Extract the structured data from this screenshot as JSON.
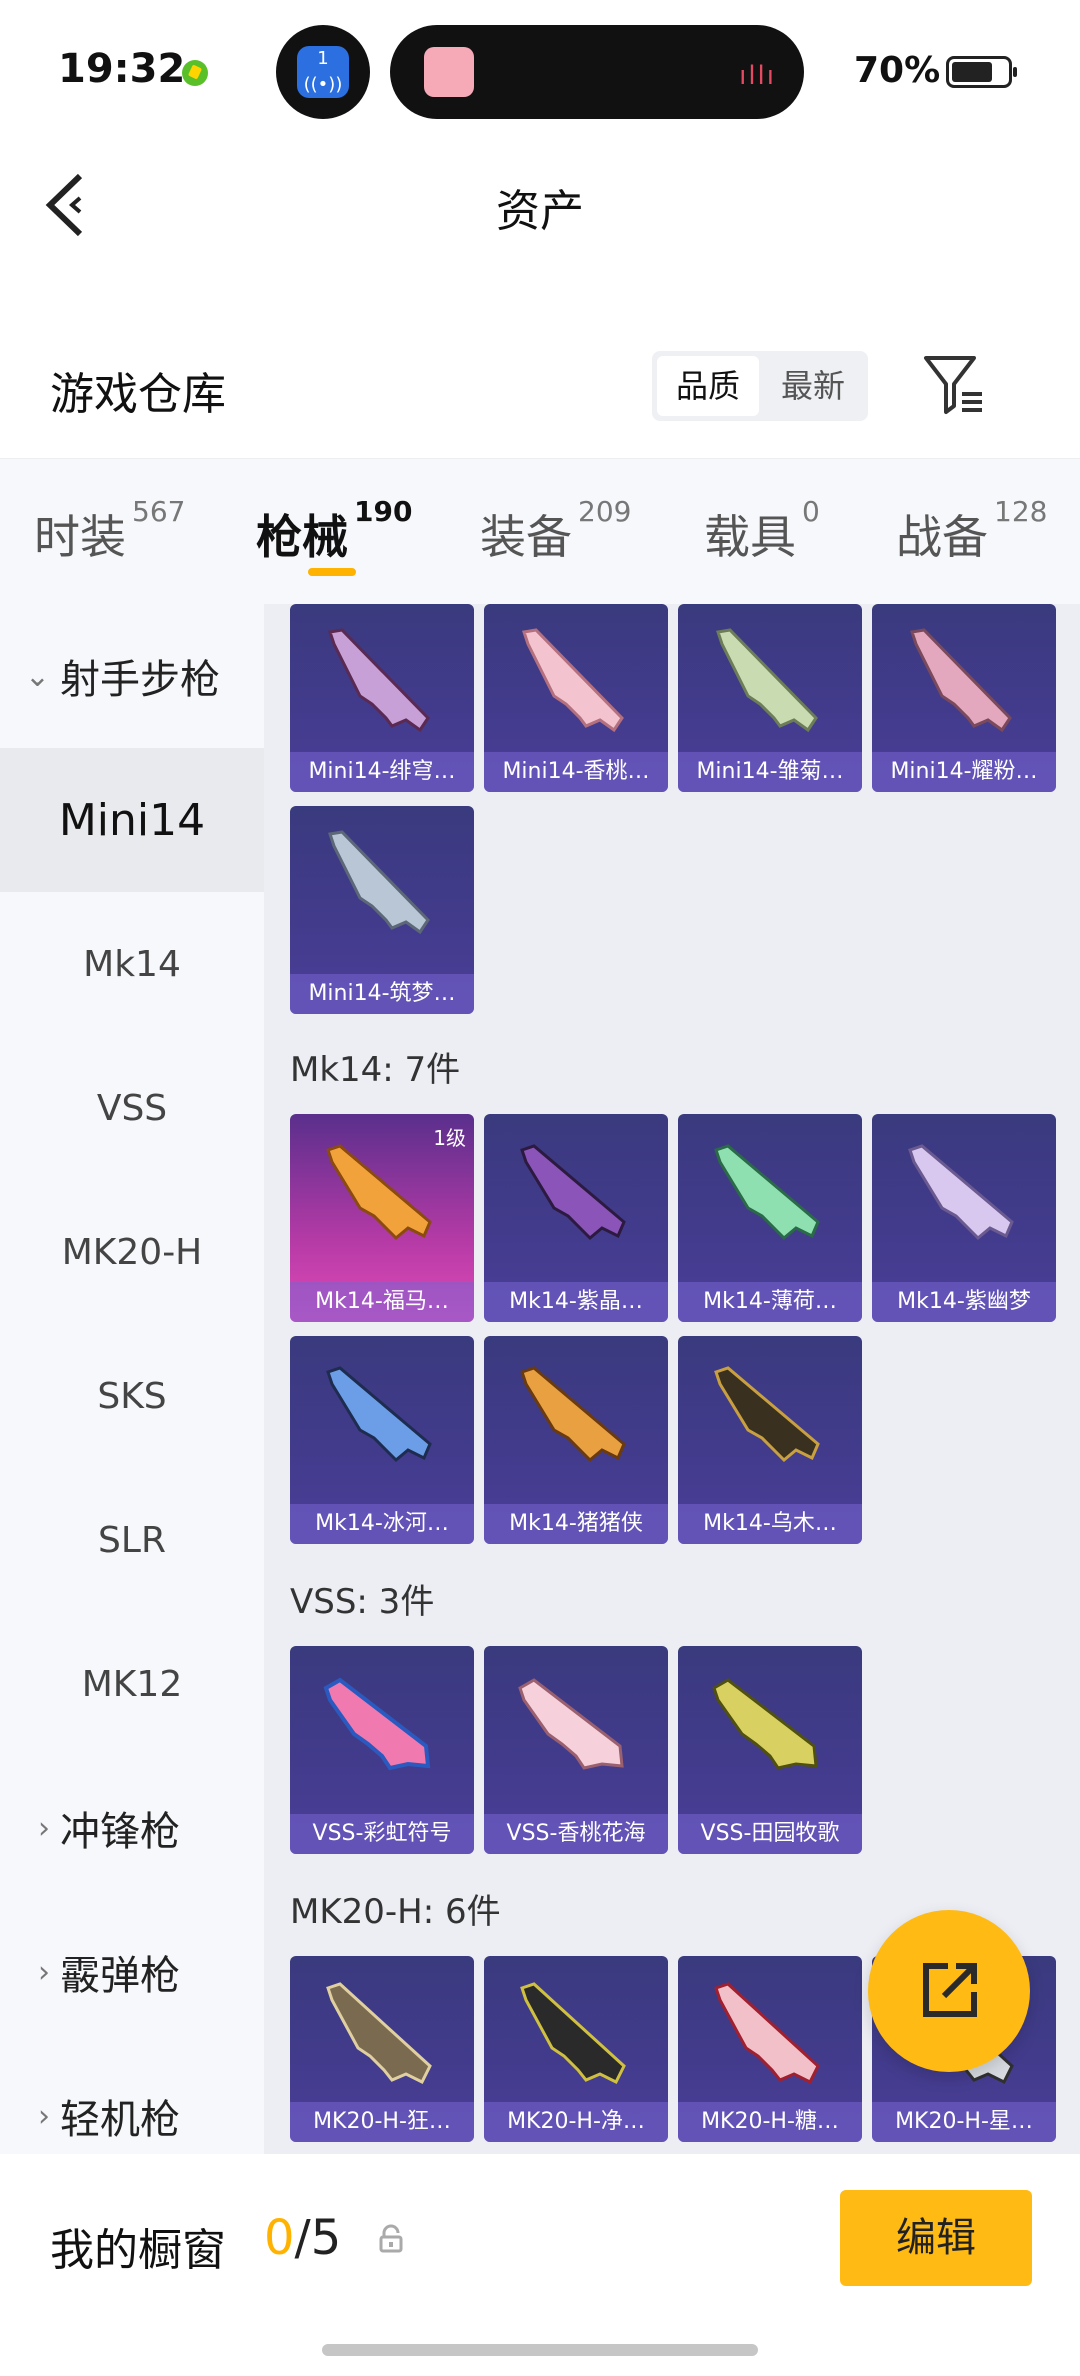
{
  "status": {
    "time": "19:32",
    "live_badge": "1",
    "wave": "ıllı",
    "battery": "70%"
  },
  "header": {
    "title": "资产"
  },
  "warehouse": {
    "title": "游戏仓库",
    "sort_options": [
      "品质",
      "最新"
    ],
    "sort_selected": "品质"
  },
  "tabs": [
    {
      "label": "时装",
      "count": "567"
    },
    {
      "label": "枪械",
      "count": "190"
    },
    {
      "label": "装备",
      "count": "209"
    },
    {
      "label": "载具",
      "count": "0"
    },
    {
      "label": "战备",
      "count": "128"
    }
  ],
  "active_tab": "枪械",
  "sidebar": {
    "category_open": "射手步枪",
    "items": [
      "Mini14",
      "Mk14",
      "VSS",
      "MK20-H",
      "SKS",
      "SLR",
      "MK12"
    ],
    "selected": "Mini14",
    "collapsed_categories": [
      "冲锋枪",
      "霰弹枪",
      "轻机枪"
    ]
  },
  "groups": {
    "mini14": {
      "items": [
        "Mini14-绯穹…",
        "Mini14-香桃…",
        "Mini14-雏菊…",
        "Mini14-耀粉…",
        "Mini14-筑梦…"
      ]
    },
    "mk14": {
      "header": "Mk14: 7件",
      "items": [
        "Mk14-福马…",
        "Mk14-紫晶…",
        "Mk14-薄荷…",
        "Mk14-紫幽梦",
        "Mk14-冰河…",
        "Mk14-猪猪侠",
        "Mk14-乌木…"
      ],
      "first_level": "1级"
    },
    "vss": {
      "header": "VSS: 3件",
      "items": [
        "VSS-彩虹符号",
        "VSS-香桃花海",
        "VSS-田园牧歌"
      ]
    },
    "mk20h": {
      "header": "MK20-H: 6件",
      "items": [
        "MK20-H-狂…",
        "MK20-H-净…",
        "MK20-H-糖…",
        "MK20-H-星…"
      ]
    }
  },
  "bottom": {
    "title": "我的橱窗",
    "current": "0",
    "total": "/5",
    "edit_label": "编辑"
  },
  "colors": {
    "accent": "#ffba14",
    "card_bg": "#3f3a8a",
    "highlight_card": "#c03fb0"
  }
}
